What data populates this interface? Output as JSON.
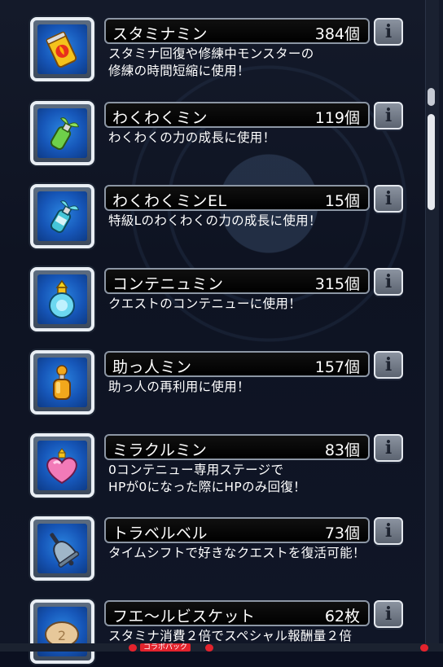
{
  "items": [
    {
      "name": "スタミナミン",
      "count": "384個",
      "desc": [
        "スタミナ回復や修練中モンスターの",
        "修練の時間短縮に使用！"
      ],
      "icon": "stamina-can-icon",
      "icon_color": "#e8301c"
    },
    {
      "name": "わくわくミン",
      "count": "119個",
      "desc": [
        "わくわくの力の成長に使用！"
      ],
      "icon": "sprout-bottle-icon",
      "icon_color": "#6ed04a"
    },
    {
      "name": "わくわくミンEL",
      "count": "15個",
      "desc": [
        "特級Lのわくわくの力の成長に使用！"
      ],
      "icon": "el-sprout-bottle-icon",
      "icon_color": "#46c6d8"
    },
    {
      "name": "コンテニュミン",
      "count": "315個",
      "desc": [
        "クエストのコンテニューに使用！"
      ],
      "icon": "continue-potion-icon",
      "icon_color": "#6cd8f0"
    },
    {
      "name": "助っ人ミン",
      "count": "157個",
      "desc": [
        "助っ人の再利用に使用！"
      ],
      "icon": "helper-bottle-icon",
      "icon_color": "#f2a81c"
    },
    {
      "name": "ミラクルミン",
      "count": "83個",
      "desc": [
        "0コンテニュー専用ステージで",
        "HPが0になった際にHPのみ回復！"
      ],
      "icon": "miracle-heart-icon",
      "icon_color": "#f27ab8"
    },
    {
      "name": "トラベルベル",
      "count": "73個",
      "desc": [
        "タイムシフトで好きなクエストを復活可能！"
      ],
      "icon": "travel-bell-icon",
      "icon_color": "#9fb6c8"
    },
    {
      "name": "フエ〜ルビスケット",
      "count": "62枚",
      "desc": [
        "スタミナ消費２倍でスペシャル報酬量２倍"
      ],
      "icon": "biscuit-icon",
      "icon_color": "#e7c89a"
    }
  ],
  "info_label": "i",
  "bottom": {
    "label": "コラボパック"
  }
}
